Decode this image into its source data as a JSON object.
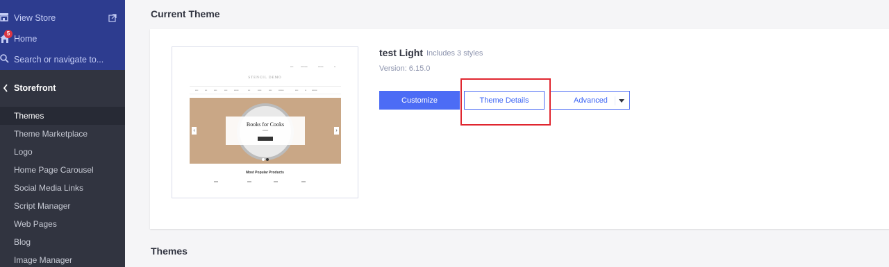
{
  "sidebar": {
    "top_items": [
      {
        "label": "View Store",
        "icon": "store-icon"
      },
      {
        "label": "Home",
        "icon": "home-icon",
        "badge": "5"
      },
      {
        "label": "Search or navigate to...",
        "icon": "search-icon"
      }
    ],
    "section": {
      "label": "Storefront",
      "icon": "chevron-left-icon"
    },
    "items": [
      {
        "label": "Themes",
        "active": true
      },
      {
        "label": "Theme Marketplace"
      },
      {
        "label": "Logo"
      },
      {
        "label": "Home Page Carousel"
      },
      {
        "label": "Social Media Links"
      },
      {
        "label": "Script Manager"
      },
      {
        "label": "Web Pages"
      },
      {
        "label": "Blog"
      },
      {
        "label": "Image Manager"
      }
    ]
  },
  "main": {
    "current_theme_heading": "Current Theme",
    "themes_heading": "Themes",
    "theme": {
      "name": "test Light",
      "styles_note": "Includes 3 styles",
      "version": "Version: 6.15.0"
    },
    "preview": {
      "logo_text": "STENCIL DEMO",
      "hero_title": "Books for Cooks",
      "popular_heading": "Most Popular Products"
    },
    "buttons": {
      "customize": "Customize",
      "theme_details": "Theme Details",
      "advanced": "Advanced"
    }
  },
  "colors": {
    "sidebar_top": "#2d3c8f",
    "sidebar": "#313440",
    "primary": "#4c6cf5",
    "highlight": "#e0262f"
  }
}
